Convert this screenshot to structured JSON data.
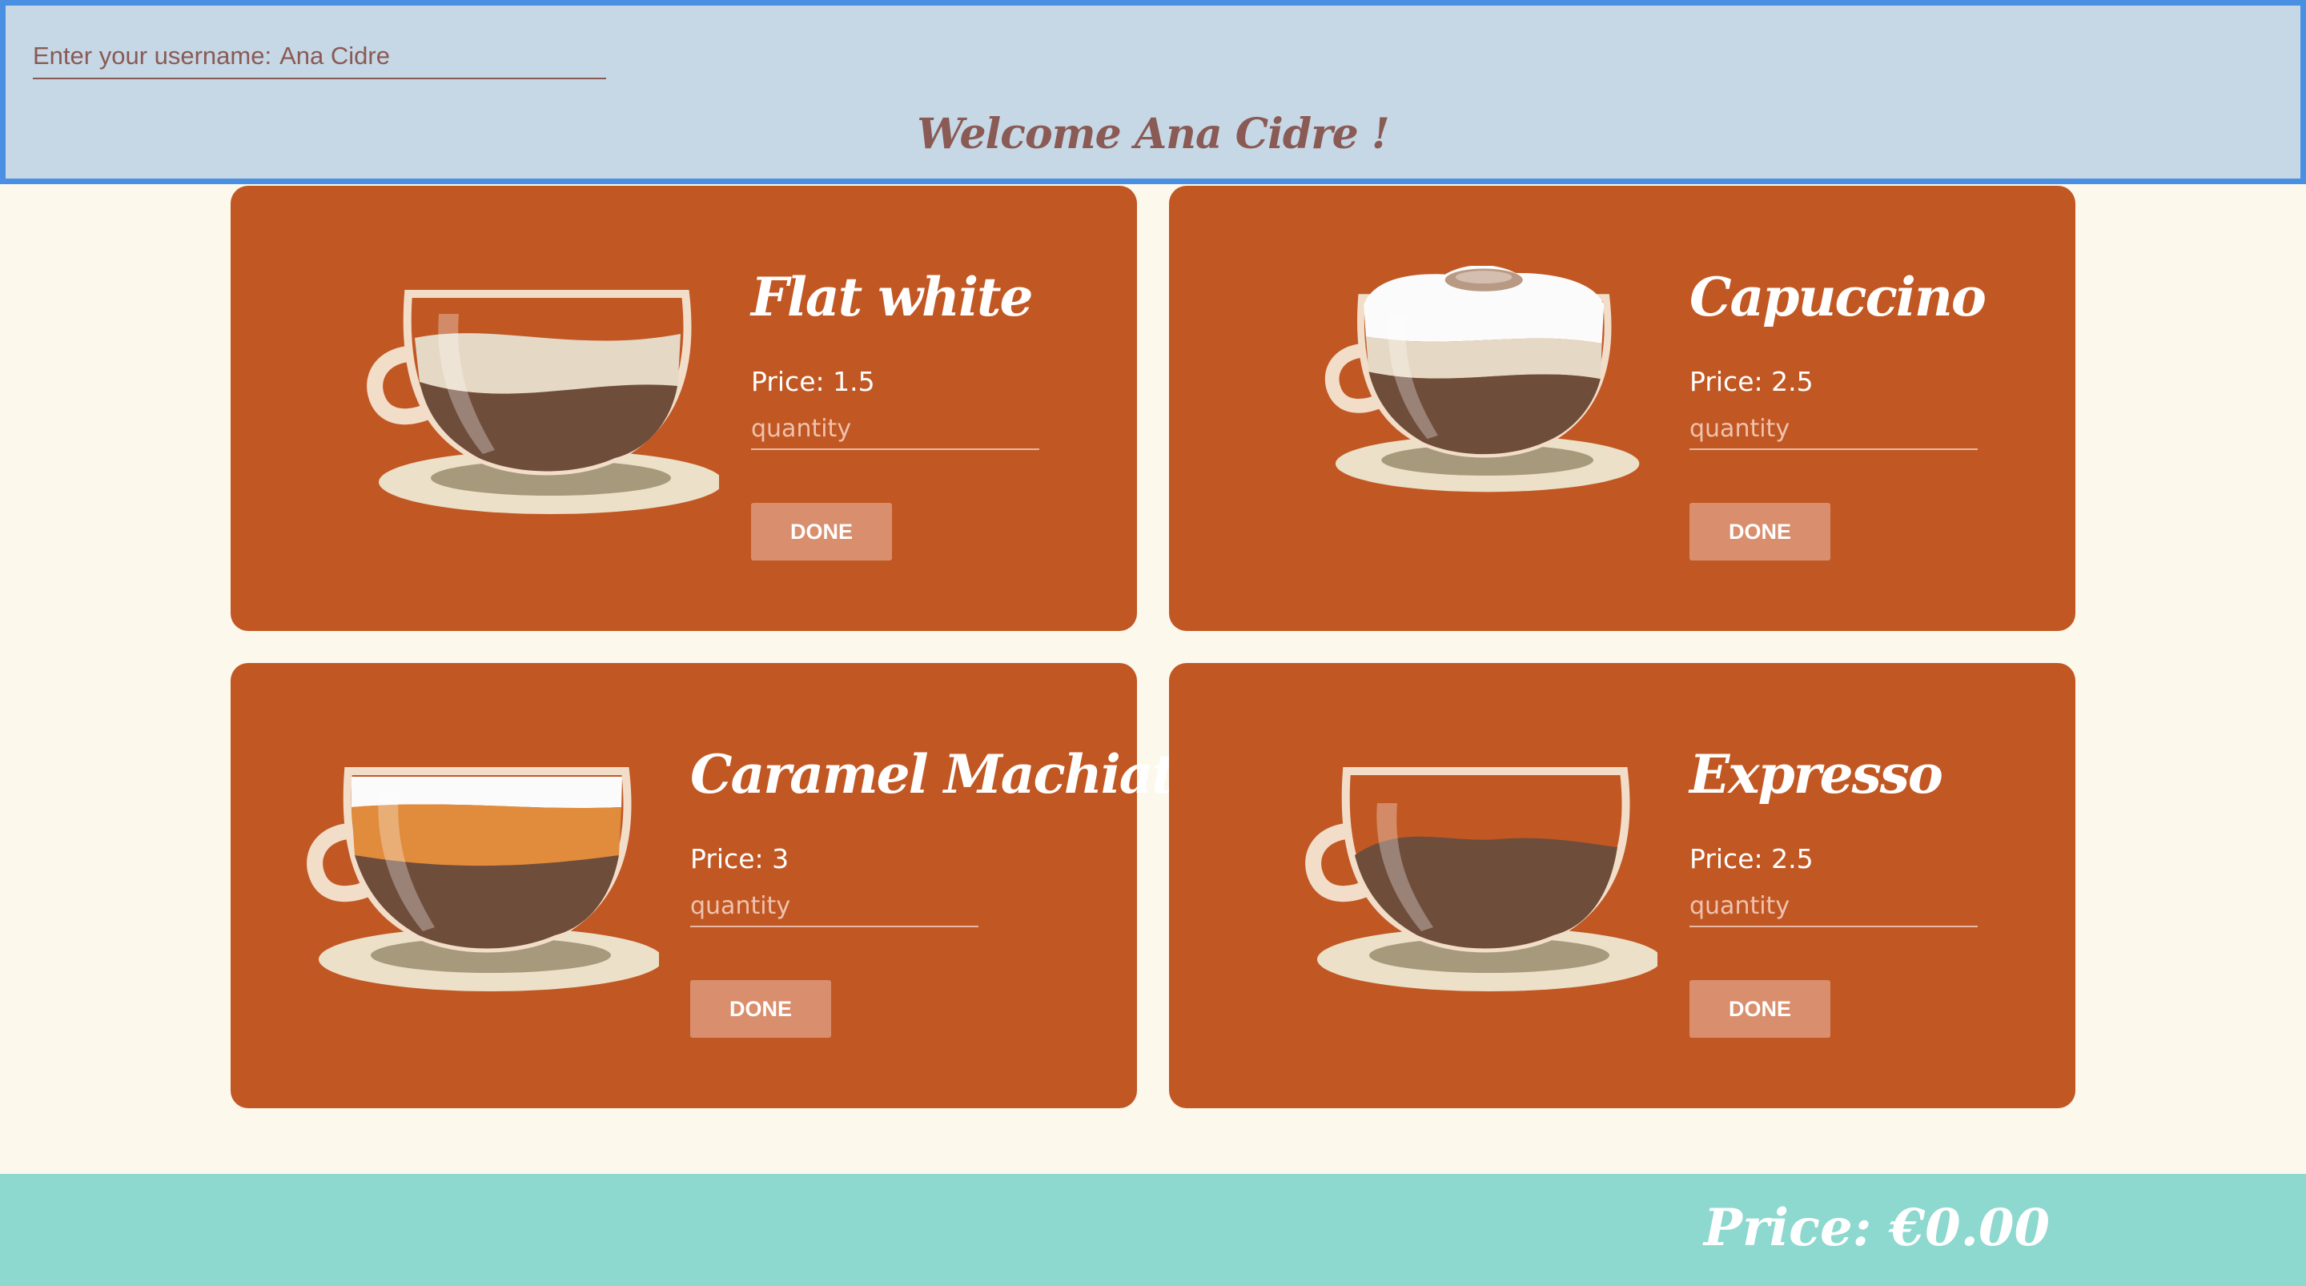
{
  "header": {
    "username_label": "Enter your username:",
    "username_value": "Ana Cidre",
    "welcome_text": "Welcome Ana Cidre !"
  },
  "products": [
    {
      "name": "Flat white",
      "price_text": "Price: 1.5",
      "quantity_placeholder": "quantity",
      "button_label": "DONE",
      "icon": "flat-white-cup-icon"
    },
    {
      "name": "Capuccino",
      "price_text": "Price: 2.5",
      "quantity_placeholder": "quantity",
      "button_label": "DONE",
      "icon": "cappuccino-cup-icon"
    },
    {
      "name": "Caramel Machiato",
      "price_text": "Price: 3",
      "quantity_placeholder": "quantity",
      "button_label": "DONE",
      "icon": "caramel-machiato-cup-icon"
    },
    {
      "name": "Expresso",
      "price_text": "Price: 2.5",
      "quantity_placeholder": "quantity",
      "button_label": "DONE",
      "icon": "espresso-cup-icon"
    }
  ],
  "footer": {
    "total_text": "Price: €0.00"
  },
  "colors": {
    "header_bg": "#c6d7e6",
    "header_border": "#4a90e2",
    "page_bg": "#fcf8ec",
    "card_bg": "#c15824",
    "button_bg": "#d98f6d",
    "footer_bg": "#8dd8cf",
    "accent_text": "#8a5a54"
  }
}
